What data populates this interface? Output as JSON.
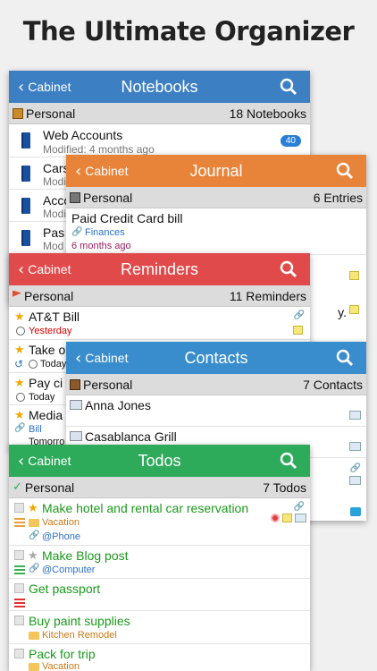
{
  "headline": "The Ultimate Organizer",
  "colors": {
    "notebooks": "#3d7fc3",
    "journal": "#e8843a",
    "reminders": "#e14a4a",
    "contacts": "#3a8dcd",
    "todos": "#2daa5a"
  },
  "notebooks": {
    "back": "Cabinet",
    "title": "Notebooks",
    "section": {
      "name": "Personal",
      "count": "18 Notebooks"
    },
    "items": [
      {
        "title": "Web Accounts",
        "sub": "Modified: 4 months ago",
        "badge": "40"
      },
      {
        "title": "Cars",
        "sub": "Modi"
      },
      {
        "title": "Acco",
        "sub": "Modi"
      },
      {
        "title": "Pas",
        "sub": "Mod"
      }
    ]
  },
  "journal": {
    "back": "Cabinet",
    "title": "Journal",
    "section": {
      "name": "Personal",
      "count": "6 Entries"
    },
    "entry": {
      "title": "Paid Credit Card bill",
      "tag": "Finances",
      "time": "6 months ago"
    },
    "peek": "y."
  },
  "reminders": {
    "back": "Cabinet",
    "title": "Reminders",
    "section": {
      "name": "Personal",
      "count": "11 Reminders"
    },
    "items": [
      {
        "title": "AT&T Bill",
        "sub": "Yesterday"
      },
      {
        "title": "Take o",
        "sub": "Today"
      },
      {
        "title": "Pay ci",
        "sub": "Today"
      },
      {
        "title": "Media",
        "sub": "Bill",
        "sub2": "Tomorro"
      }
    ]
  },
  "contacts": {
    "back": "Cabinet",
    "title": "Contacts",
    "section": {
      "name": "Personal",
      "count": "7 Contacts"
    },
    "items": [
      {
        "name": "Anna Jones"
      },
      {
        "name": "Casablanca Grill"
      }
    ]
  },
  "todos": {
    "back": "Cabinet",
    "title": "Todos",
    "section": {
      "name": "Personal",
      "count": "7 Todos"
    },
    "items": [
      {
        "title": "Make hotel and rental car reservation",
        "folder": "Vacation",
        "context": "@Phone"
      },
      {
        "title": "Make Blog post",
        "context": "@Computer"
      },
      {
        "title": "Get passport"
      },
      {
        "title": "Buy paint supplies",
        "folder": "Kitchen Remodel"
      },
      {
        "title": "Pack for trip",
        "folder": "Vacation"
      }
    ]
  }
}
